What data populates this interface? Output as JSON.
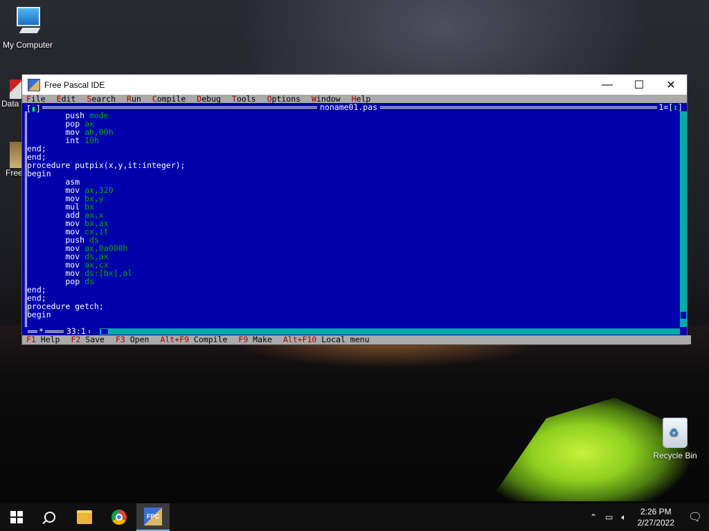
{
  "desktop": {
    "icons": [
      {
        "label": "My Computer"
      },
      {
        "label": "Data"
      },
      {
        "label": "Free"
      },
      {
        "label": "Recycle Bin"
      }
    ]
  },
  "window": {
    "title": "Free Pascal IDE",
    "controls": {
      "minimize": "—",
      "maximize": "☐",
      "close": "✕"
    },
    "menu": [
      {
        "hot": "F",
        "rest": "ile"
      },
      {
        "hot": "E",
        "rest": "dit"
      },
      {
        "hot": "S",
        "rest": "earch"
      },
      {
        "hot": "R",
        "rest": "un"
      },
      {
        "hot": "C",
        "rest": "ompile"
      },
      {
        "hot": "D",
        "rest": "ebug"
      },
      {
        "hot": "T",
        "rest": "ools"
      },
      {
        "hot": "O",
        "rest": "ptions"
      },
      {
        "hot": "W",
        "rest": "indow"
      },
      {
        "hot": "H",
        "rest": "elp"
      }
    ],
    "editor": {
      "frame_left": "[",
      "frame_left_mark": "▮",
      "frame_left_end": "]",
      "filename": "noname01.pas",
      "frame_right": "1=[",
      "frame_right_mark": "↕",
      "frame_right_end": "]",
      "cursor_pos": "33:1",
      "frame_bottom_mark": "*",
      "lines": [
        {
          "kw": "        push ",
          "arg": "mode"
        },
        {
          "kw": "        pop ",
          "arg": "ax"
        },
        {
          "kw": "        mov ",
          "arg": "ah,00h"
        },
        {
          "kw": "        int ",
          "arg": "10h"
        },
        {
          "kw": "end;",
          "arg": ""
        },
        {
          "kw": "end;",
          "arg": ""
        },
        {
          "kw": "procedure putpix(x,y,it:integer);",
          "arg": ""
        },
        {
          "kw": "begin",
          "arg": ""
        },
        {
          "kw": "        asm",
          "arg": ""
        },
        {
          "kw": "        mov ",
          "arg": "ax,320"
        },
        {
          "kw": "        mov ",
          "arg": "bx,y"
        },
        {
          "kw": "        mul ",
          "arg": "bx"
        },
        {
          "kw": "        add ",
          "arg": "ax,x"
        },
        {
          "kw": "        mov ",
          "arg": "bx,ax"
        },
        {
          "kw": "        mov ",
          "arg": "cx,it"
        },
        {
          "kw": "        push ",
          "arg": "ds"
        },
        {
          "kw": "        mov ",
          "arg": "ax,0a000h"
        },
        {
          "kw": "        mov ",
          "arg": "ds,ax"
        },
        {
          "kw": "        mov ",
          "arg": "ax,cx"
        },
        {
          "kw": "        mov ",
          "arg": "ds:[bx],al"
        },
        {
          "kw": "        pop ",
          "arg": "ds"
        },
        {
          "kw": "end;",
          "arg": ""
        },
        {
          "kw": "end;",
          "arg": ""
        },
        {
          "kw": "procedure getch;",
          "arg": ""
        },
        {
          "kw": "begin",
          "arg": ""
        },
        {
          "kw": "_",
          "arg": ""
        }
      ]
    },
    "status": [
      {
        "key": "F1",
        "label": " Help"
      },
      {
        "key": "F2",
        "label": " Save"
      },
      {
        "key": "F3",
        "label": " Open"
      },
      {
        "key": "Alt+F9",
        "label": " Compile"
      },
      {
        "key": "F9",
        "label": " Make"
      },
      {
        "key": "Alt+F10",
        "label": " Local menu"
      }
    ]
  },
  "taskbar": {
    "time": "2:26 PM",
    "date": "2/27/2022",
    "tray_icons": [
      "chevron-up-icon",
      "network-icon",
      "volume-icon"
    ],
    "notification_icon": "notification-icon",
    "fpc_label": "FPC"
  }
}
